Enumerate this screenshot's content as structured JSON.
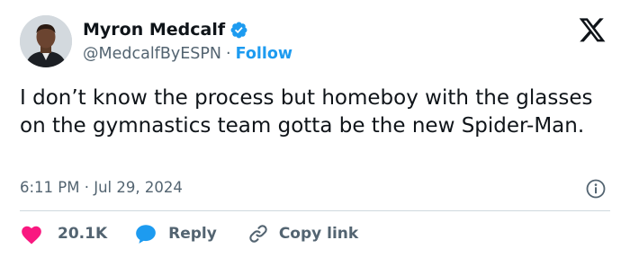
{
  "author": {
    "display_name": "Myron Medcalf",
    "handle": "@MedcalfByESPN",
    "separator": "·",
    "follow_label": "Follow",
    "verified_color": "#1d9bf0"
  },
  "tweet": {
    "text": "I don’t know the process but homeboy with the glasses on the gymnastics team gotta be the new Spider-Man.",
    "timestamp": "6:11 PM · Jul 29, 2024"
  },
  "actions": {
    "like_count": "20.1K",
    "like_color": "#f91880",
    "reply_label": "Reply",
    "reply_color": "#1d9bf0",
    "copy_label": "Copy link"
  },
  "icons": {
    "verified": "verified-badge-icon",
    "x_logo": "x-logo-icon",
    "info": "info-icon",
    "heart": "heart-icon",
    "reply": "reply-bubble-icon",
    "link": "link-icon"
  }
}
